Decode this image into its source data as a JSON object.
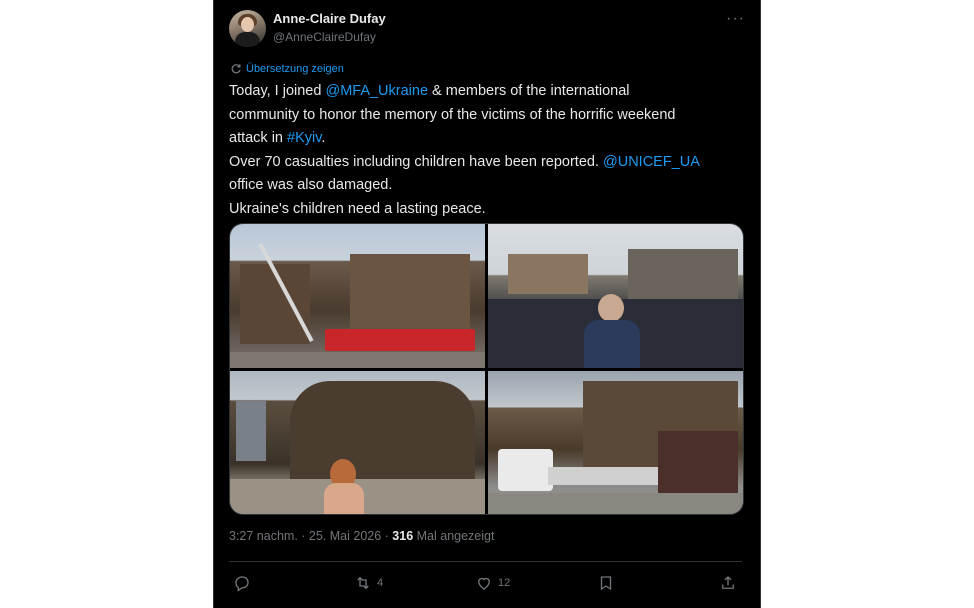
{
  "author": {
    "name": "Anne-Claire Dufay",
    "handle": "@AnneClaireDufay"
  },
  "translate_label": "Übersetzung zeigen",
  "tweet": {
    "line1_pre": "Today, I joined ",
    "line1_mention": "@MFA_Ukraine",
    "line1_post": " & members of the international",
    "line2": "community to honor the memory of the victims of the horrific weekend",
    "line3_pre": "attack in ",
    "line3_hashtag": "#Kyiv",
    "line3_post": ".",
    "line4_pre": "Over 70 casualties including children have been reported. ",
    "line4_mention": "@UNICEF_UA",
    "line5": "office was also damaged.",
    "line6": "Ukraine's children need a lasting peace."
  },
  "meta": {
    "time": "3:27 nachm.",
    "sep1": " · ",
    "date": "25. Mai 2026",
    "sep2": " · ",
    "views": "316",
    "views_label": " Mal angezeigt"
  },
  "actions": {
    "reply_count": "",
    "retweet_count": "4",
    "like_count": "12"
  },
  "icons": {
    "more": "more-icon",
    "reply": "reply-icon",
    "retweet": "retweet-icon",
    "like": "heart-icon",
    "bookmark": "bookmark-icon",
    "share": "share-icon"
  },
  "colors": {
    "background": "#000000",
    "text": "#e7e9ea",
    "secondary": "#71767b",
    "link": "#1d9bf0"
  }
}
